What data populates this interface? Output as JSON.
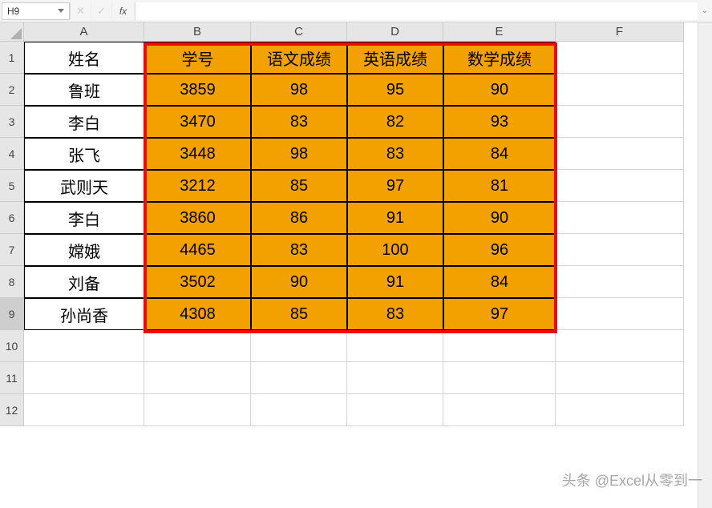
{
  "name_box": "H9",
  "formula_value": "",
  "columns": [
    "A",
    "B",
    "C",
    "D",
    "E",
    "F"
  ],
  "row_labels": [
    "1",
    "2",
    "3",
    "4",
    "5",
    "6",
    "7",
    "8",
    "9",
    "10",
    "11",
    "12"
  ],
  "active_row": "9",
  "chart_data": {
    "type": "table",
    "title": "",
    "headers_plain": [
      "姓名"
    ],
    "headers_highlight": [
      "学号",
      "语文成绩",
      "英语成绩",
      "数学成绩"
    ],
    "rows": [
      {
        "name": "鲁班",
        "id": 3859,
        "chinese": 98,
        "english": 95,
        "math": 90
      },
      {
        "name": "李白",
        "id": 3470,
        "chinese": 83,
        "english": 82,
        "math": 93
      },
      {
        "name": "张飞",
        "id": 3448,
        "chinese": 98,
        "english": 83,
        "math": 84
      },
      {
        "name": "武则天",
        "id": 3212,
        "chinese": 85,
        "english": 97,
        "math": 81
      },
      {
        "name": "李白",
        "id": 3860,
        "chinese": 86,
        "english": 91,
        "math": 90
      },
      {
        "name": "嫦娥",
        "id": 4465,
        "chinese": 83,
        "english": 100,
        "math": 96
      },
      {
        "name": "刘备",
        "id": 3502,
        "chinese": 90,
        "english": 91,
        "math": 84
      },
      {
        "name": "孙尚香",
        "id": 4308,
        "chinese": 85,
        "english": 83,
        "math": 97
      }
    ]
  },
  "fx_label": "fx",
  "watermark": "头条 @Excel从零到一",
  "colors": {
    "highlight_fill": "#f2a100",
    "red_frame": "#ff0000"
  }
}
